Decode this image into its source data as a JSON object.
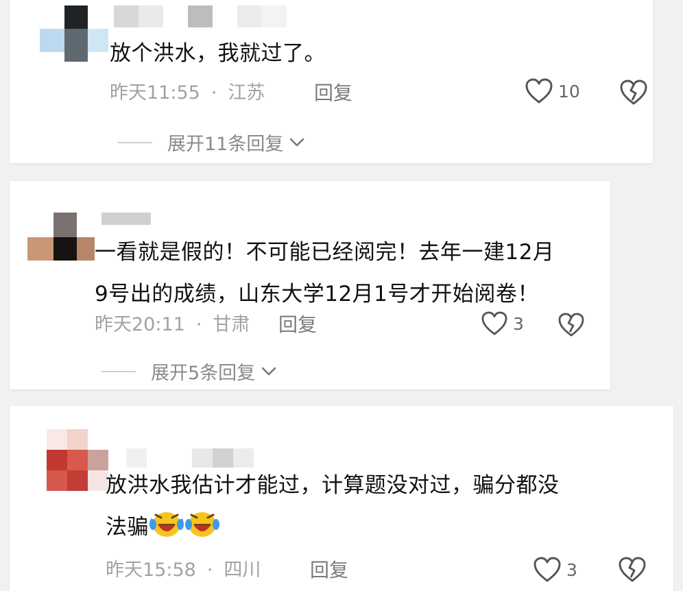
{
  "comments": [
    {
      "content": "放个洪水，我就过了。",
      "time": "昨天11:55",
      "separator": "·",
      "location": "江苏",
      "reply_label": "回复",
      "likes": "10",
      "expand_label": "展开11条回复"
    },
    {
      "content_line1": "一看就是假的！不可能已经阅完！去年一建12月",
      "content_line2": "9号出的成绩，山东大学12月1号才开始阅卷！",
      "time": "昨天20:11",
      "separator": "·",
      "location": "甘肃",
      "reply_label": "回复",
      "likes": "3",
      "expand_label": "展开5条回复"
    },
    {
      "content_line1": "放洪水我估计才能过，计算题没对过，骗分都没",
      "content_line2": "法骗",
      "emoji": [
        "laughing-crying-emoji",
        "laughing-crying-emoji"
      ],
      "time": "昨天15:58",
      "separator": "·",
      "location": "四川",
      "reply_label": "回复",
      "likes": "3"
    }
  ],
  "colors": {
    "background": "#f1f1f1",
    "card": "#ffffff",
    "text": "#111111",
    "meta": "#a2a2a2",
    "icon": "#555555"
  }
}
